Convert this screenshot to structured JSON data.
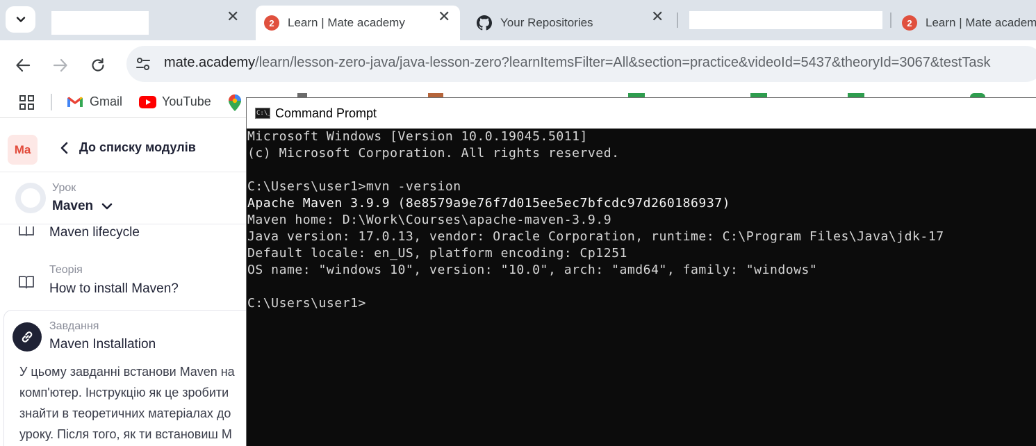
{
  "browser": {
    "tabs": [
      {
        "title": "",
        "badge": "",
        "redacted": true
      },
      {
        "title": "Learn | Mate academy",
        "badge": "2",
        "active": true
      },
      {
        "title": "Your Repositories",
        "badge": ""
      },
      {
        "title": "",
        "badge": "",
        "redacted": true
      },
      {
        "title": "Learn | Mate academ",
        "badge": "2"
      }
    ],
    "close_glyph": "✕",
    "url_host": "mate.academy",
    "url_path": "/learn/lesson-zero-java/java-lesson-zero?learnItemsFilter=All&section=practice&videoId=5437&theoryId=3067&testTask",
    "bookmarks": [
      {
        "label": "Gmail",
        "icon": "gmail-icon"
      },
      {
        "label": "YouTube",
        "icon": "youtube-icon"
      }
    ]
  },
  "page": {
    "logo": "Ma",
    "back_label": "До списку модулів",
    "lesson_caption": "Урок",
    "lesson_name": "Maven",
    "items": [
      {
        "caption": "",
        "title": "Maven lifecycle"
      },
      {
        "caption": "Теорія",
        "title": "How to install Maven?"
      }
    ],
    "task": {
      "caption": "Завдання",
      "title": "Maven Installation",
      "description_lines": [
        "У цьому завданні встанови Maven на",
        "комп'ютер. Інструкцію як це зробити",
        "знайти в теоретичних матеріалах до",
        "уроку. Після того, як ти встановиш М"
      ]
    }
  },
  "cmd": {
    "icon_text": "C:\\_",
    "title": "Command Prompt",
    "lines": [
      "Microsoft Windows [Version 10.0.19045.5011]",
      "(c) Microsoft Corporation. All rights reserved.",
      "",
      "C:\\Users\\user1>mvn -version",
      "Apache Maven 3.9.9 (8e8579a9e76f7d015ee5ec7bfcdc97d260186937)",
      "Maven home: D:\\Work\\Courses\\apache-maven-3.9.9",
      "Java version: 17.0.13, vendor: Oracle Corporation, runtime: C:\\Program Files\\Java\\jdk-17",
      "Default locale: en_US, platform encoding: Cp1251",
      "OS name: \"windows 10\", version: \"10.0\", arch: \"amd64\", family: \"windows\"",
      "",
      "C:\\Users\\user1>"
    ]
  },
  "colors": {
    "tabstrip": "#dde3ea",
    "badge": "#e0503e",
    "console_bg": "#0c0c0c",
    "console_text": "#d7d7d7",
    "brand": "#e24b3b"
  }
}
